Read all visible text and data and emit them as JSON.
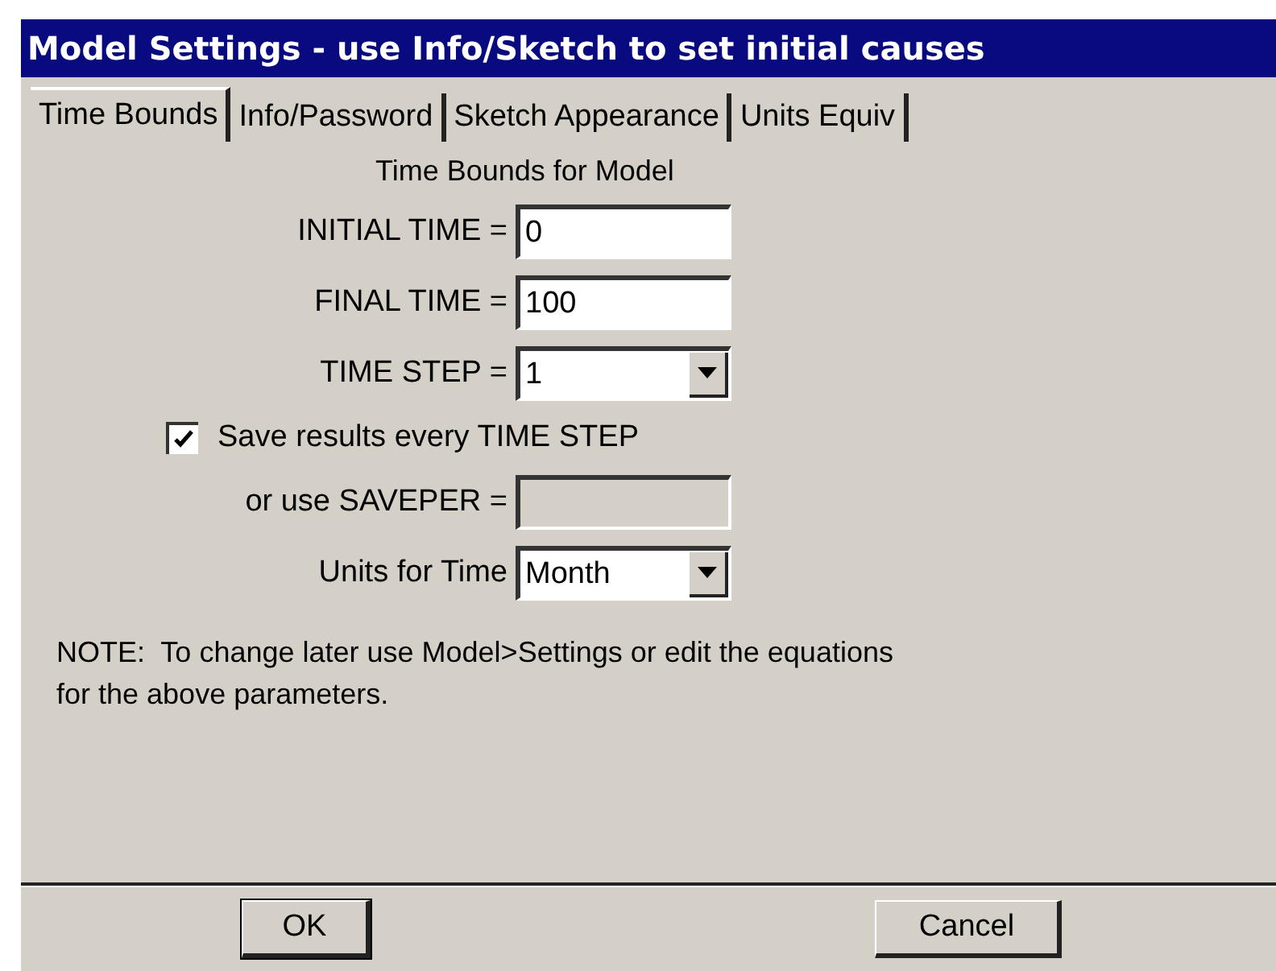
{
  "window": {
    "title": "Model Settings - use Info/Sketch to set initial causes"
  },
  "tabs": [
    {
      "label": "Time Bounds",
      "selected": true
    },
    {
      "label": "Info/Password",
      "selected": false
    },
    {
      "label": "Sketch Appearance",
      "selected": false
    },
    {
      "label": "Units Equiv",
      "selected": false
    }
  ],
  "section_title": "Time Bounds for Model",
  "fields": [
    {
      "kind": "text",
      "label": "INITIAL TIME =",
      "value": "0",
      "disabled": false
    },
    {
      "kind": "text",
      "label": "FINAL TIME =",
      "value": "100",
      "disabled": false
    },
    {
      "kind": "dropdown",
      "label": "TIME STEP =",
      "value": "1",
      "disabled": false
    },
    {
      "kind": "checkbox",
      "label": "Save results every TIME STEP",
      "checked": true
    },
    {
      "kind": "text",
      "label": "or use SAVEPER =",
      "disabled": true
    },
    {
      "kind": "dropdown",
      "label": "Units for Time",
      "value": "Month",
      "disabled": false
    }
  ],
  "note": "NOTE:  To change later use Model>Settings or edit the equations\nfor the above parameters.",
  "buttons": [
    {
      "label": "OK",
      "default": true
    },
    {
      "label": "Cancel",
      "default": false
    }
  ]
}
